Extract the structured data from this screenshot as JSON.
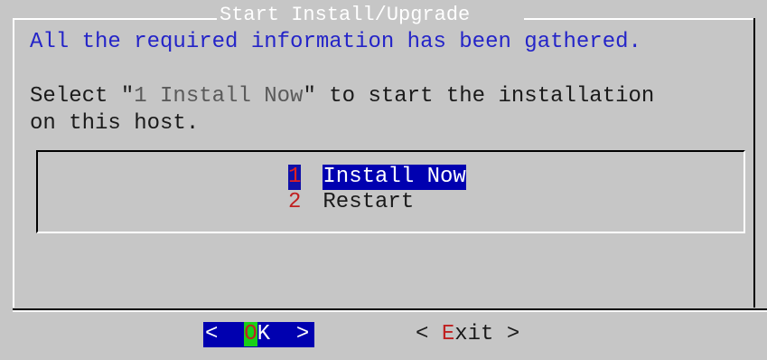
{
  "dialog": {
    "title": "Start Install/Upgrade",
    "message_line1": "All the required information has been gathered.",
    "message_line2_prefix": "Select \"",
    "message_line2_quoted": "1 Install Now",
    "message_line2_suffix": "\" to start the installation",
    "message_line3": "on this host."
  },
  "menu": {
    "items": [
      {
        "tag": "1",
        "label": "Install Now",
        "selected": true
      },
      {
        "tag": "2",
        "label": "Restart",
        "selected": false
      }
    ]
  },
  "buttons": {
    "ok": {
      "left": "<  ",
      "hotkey": "O",
      "rest": "K  >"
    },
    "exit": {
      "left": "< ",
      "hotkey": "E",
      "rest": "xit >"
    }
  },
  "colors": {
    "background": "#c6c6c6",
    "highlight": "#0000b0",
    "hotkey": "#c02020",
    "hotkey_bg": "#18d018",
    "message": "#2424c8"
  }
}
